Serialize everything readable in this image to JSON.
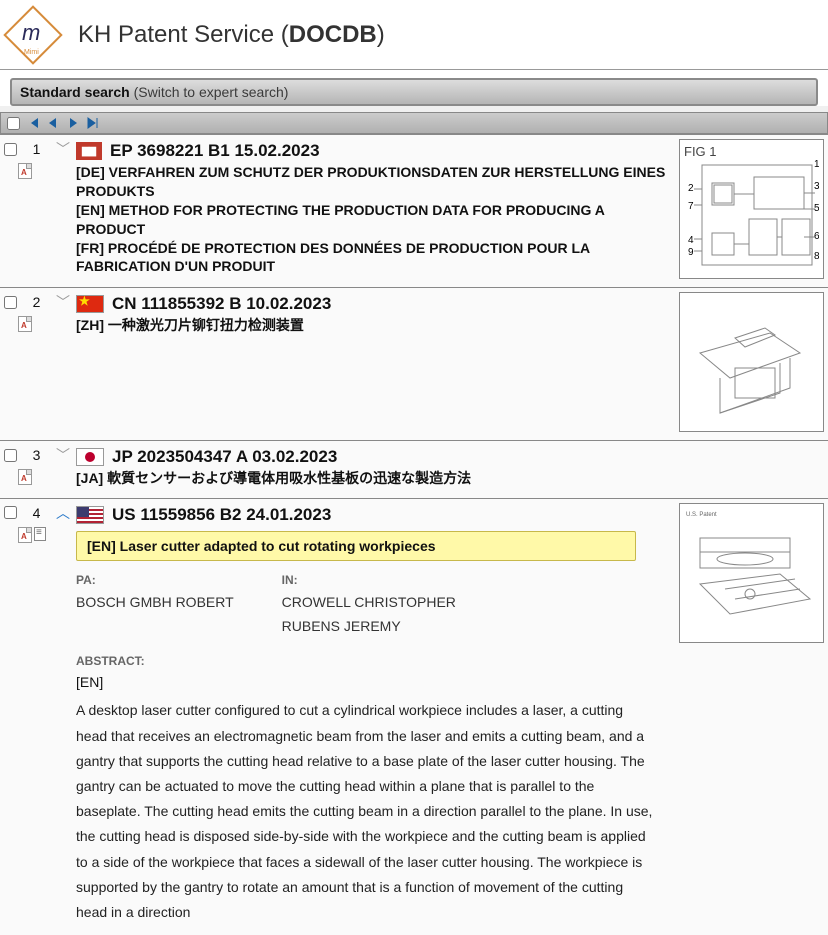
{
  "header": {
    "title_prefix": "KH Patent Service (",
    "title_bold": "DOCDB",
    "title_suffix": ")"
  },
  "search_bar": {
    "bold": "Standard search",
    "switch_text": " (Switch to expert search)"
  },
  "results": [
    {
      "num": "1",
      "expanded": false,
      "has_doc_icon": false,
      "flag": "badge",
      "pub": "EP 3698221 B1 15.02.2023",
      "titles": [
        {
          "lang": "[DE]",
          "text": " VERFAHREN ZUM SCHUTZ DER PRODUKTIONSDATEN ZUR HERSTELLUNG EINES PRODUKTS"
        },
        {
          "lang": "[EN]",
          "text": " METHOD FOR PROTECTING THE PRODUCTION DATA FOR PRODUCING A PRODUCT"
        },
        {
          "lang": "[FR]",
          "text": " PROCÉDÉ DE PROTECTION DES DONNÉES DE PRODUCTION POUR LA FABRICATION D'UN PRODUIT"
        }
      ],
      "thumb": "fig1",
      "fig_label": "FIG 1",
      "fig_nums": [
        "1",
        "2",
        "3",
        "4",
        "5",
        "6",
        "7",
        "8",
        "9"
      ]
    },
    {
      "num": "2",
      "expanded": false,
      "has_doc_icon": false,
      "flag": "cn",
      "pub": "CN 111855392 B 10.02.2023",
      "titles": [
        {
          "lang": "[ZH]",
          "text": " 一种激光刀片铆钉扭力检测装置"
        }
      ],
      "thumb": "machine"
    },
    {
      "num": "3",
      "expanded": false,
      "has_doc_icon": false,
      "flag": "jp",
      "pub": "JP 2023504347 A 03.02.2023",
      "titles": [
        {
          "lang": "[JA]",
          "text": " 軟質センサーおよび導電体用吸水性基板の迅速な製造方法"
        }
      ],
      "thumb": "none"
    },
    {
      "num": "4",
      "expanded": true,
      "has_doc_icon": true,
      "flag": "us",
      "pub": "US 11559856 B2 24.01.2023",
      "highlight": {
        "lang": "[EN]",
        "text": " Laser cutter adapted to cut rotating workpieces"
      },
      "meta": {
        "pa_label": "PA:",
        "pa_values": [
          "BOSCH GMBH ROBERT"
        ],
        "in_label": "IN:",
        "in_values": [
          "CROWELL CHRISTOPHER",
          "RUBENS JEREMY"
        ]
      },
      "abstract_label": "ABSTRACT:",
      "abstract_lang": "[EN]",
      "abstract_text": "A desktop laser cutter configured to cut a cylindrical workpiece includes a laser, a cutting head that receives an electromagnetic beam from the laser and emits a cutting beam, and a gantry that supports the cutting head relative to a base plate of the laser cutter housing. The gantry can be actuated to move the cutting head within a plane that is parallel to the baseplate. The cutting head emits the cutting beam in a direction parallel to the plane. In use, the cutting head is disposed side-by-side with the workpiece and the cutting beam is applied to a side of the workpiece that faces a sidewall of the laser cutter housing. The workpiece is supported by the gantry to rotate an amount that is a function of movement of the cutting head in a direction",
      "thumb": "lasercutter"
    }
  ]
}
